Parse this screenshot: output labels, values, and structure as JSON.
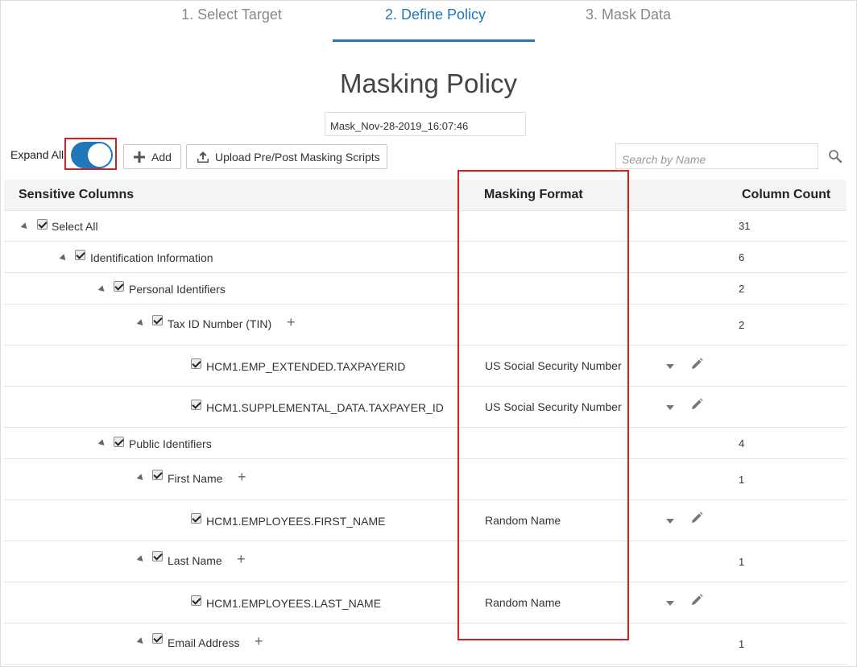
{
  "steps": [
    {
      "label": "1. Select Target",
      "active": false
    },
    {
      "label": "2. Define Policy",
      "active": true
    },
    {
      "label": "3. Mask Data",
      "active": false
    }
  ],
  "page_title": "Masking Policy",
  "policy_name": "Mask_Nov-28-2019_16:07:46",
  "toolbar": {
    "expand_all_label": "Expand All",
    "expand_all_on": true,
    "add_label": "Add",
    "upload_label": "Upload Pre/Post Masking Scripts",
    "search_placeholder": "Search by Name"
  },
  "table": {
    "headers": {
      "sensitive_columns": "Sensitive Columns",
      "masking_format": "Masking Format",
      "column_count": "Column Count"
    },
    "rows": [
      {
        "label": "Select All",
        "count": "31",
        "format": ""
      },
      {
        "label": "Identification Information",
        "count": "6",
        "format": ""
      },
      {
        "label": "Personal Identifiers",
        "count": "2",
        "format": ""
      },
      {
        "label": "Tax ID Number (TIN)",
        "count": "2",
        "format": ""
      },
      {
        "label": "HCM1.EMP_EXTENDED.TAXPAYERID",
        "count": "",
        "format": "US Social Security Number"
      },
      {
        "label": "HCM1.SUPPLEMENTAL_DATA.TAXPAYER_ID",
        "count": "",
        "format": "US Social Security Number"
      },
      {
        "label": "Public Identifiers",
        "count": "4",
        "format": ""
      },
      {
        "label": "First Name",
        "count": "1",
        "format": ""
      },
      {
        "label": "HCM1.EMPLOYEES.FIRST_NAME",
        "count": "",
        "format": "Random Name"
      },
      {
        "label": "Last Name",
        "count": "1",
        "format": ""
      },
      {
        "label": "HCM1.EMPLOYEES.LAST_NAME",
        "count": "",
        "format": "Random Name"
      },
      {
        "label": "Email Address",
        "count": "1",
        "format": ""
      }
    ]
  },
  "colors": {
    "accent": "#1f78b9",
    "highlight": "#d61e1e"
  }
}
